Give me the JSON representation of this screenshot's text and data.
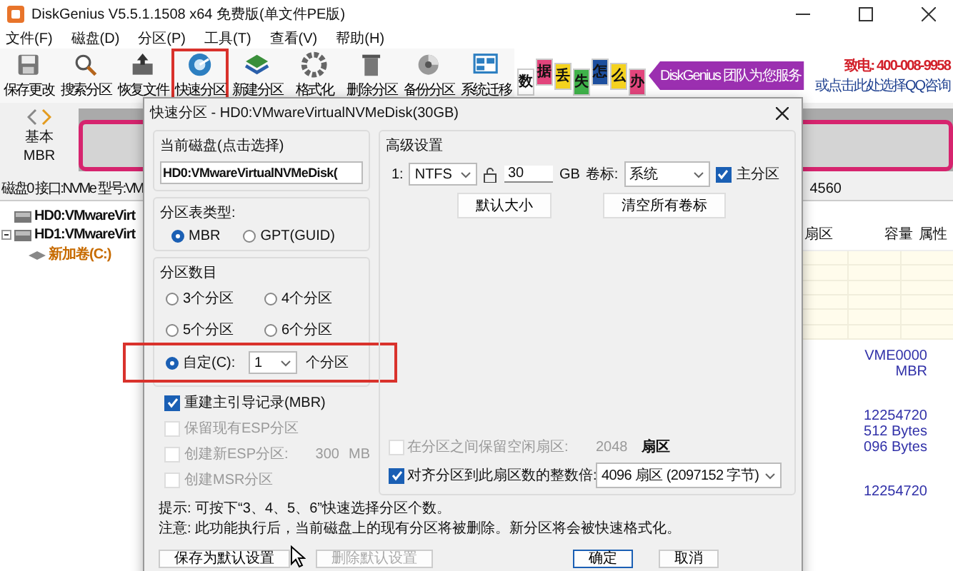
{
  "window": {
    "title": "DiskGenius V5.5.1.1508 x64 免费版(单文件PE版)"
  },
  "menu": [
    "文件(F)",
    "磁盘(D)",
    "分区(P)",
    "工具(T)",
    "查看(V)",
    "帮助(H)"
  ],
  "toolbar": [
    {
      "label": "保存更改",
      "highlighted": false
    },
    {
      "label": "搜索分区",
      "highlighted": false
    },
    {
      "label": "恢复文件",
      "highlighted": false
    },
    {
      "label": "快速分区",
      "highlighted": true
    },
    {
      "label": "新建分区",
      "highlighted": false
    },
    {
      "label": "格式化",
      "highlighted": false
    },
    {
      "label": "删除分区",
      "highlighted": false
    },
    {
      "label": "备份分区",
      "highlighted": false
    },
    {
      "label": "系统迁移",
      "highlighted": false
    }
  ],
  "banner": {
    "tiles": [
      {
        "text": "数",
        "color": "#ffffff"
      },
      {
        "text": "据",
        "color": "#e2457c"
      },
      {
        "text": "丢",
        "color": "#f4d21f"
      },
      {
        "text": "失",
        "color": "#3fb24a"
      },
      {
        "text": "怎",
        "color": "#1d4f9e"
      },
      {
        "text": "么",
        "color": "#f4d21f"
      },
      {
        "text": "办",
        "color": "#e2457c"
      }
    ],
    "slogan": "DiskGenius 团队为您服务",
    "phone": "致电: 400-008-9958",
    "qq": "或点击此处选择QQ咨询"
  },
  "disk_map": {
    "type": "基本",
    "scheme": "MBR"
  },
  "disk_info": {
    "text": "磁盘0 接口:NVMe 型号:VM",
    "tail": "4560"
  },
  "tree": [
    {
      "label": "HD0:VMwareVirt"
    },
    {
      "label": "HD1:VMwareVirt",
      "children": [
        {
          "label": "新加卷(C:)"
        }
      ]
    }
  ],
  "table": {
    "columns": [
      "扇区",
      "容量",
      "属性"
    ]
  },
  "details": [
    [
      "VME0000",
      "MBR"
    ],
    [
      "12254720",
      "512 Bytes",
      "096 Bytes"
    ],
    [
      "12254720"
    ]
  ],
  "dialog": {
    "title": "快速分区 - HD0:VMwareVirtualNVMeDisk(30GB)",
    "current_disk": {
      "label": "当前磁盘(点击选择)",
      "value": "HD0:VMwareVirtualNVMeDisk("
    },
    "partition_table": {
      "label": "分区表类型:",
      "options": [
        {
          "label": "MBR",
          "selected": true
        },
        {
          "label": "GPT(GUID)",
          "selected": false
        }
      ]
    },
    "partition_count": {
      "label": "分区数目",
      "options": [
        {
          "label": "3个分区",
          "selected": false
        },
        {
          "label": "4个分区",
          "selected": false
        },
        {
          "label": "5个分区",
          "selected": false
        },
        {
          "label": "6个分区",
          "selected": false
        }
      ],
      "custom": {
        "label": "自定(C):",
        "selected": true,
        "value": "1",
        "unit": "个分区",
        "highlighted": true
      }
    },
    "options": [
      {
        "label": "重建主引导记录(MBR)",
        "checked": true,
        "disabled": false
      },
      {
        "label": "保留现有ESP分区",
        "checked": false,
        "disabled": true
      },
      {
        "label": "创建新ESP分区:",
        "checked": false,
        "disabled": true,
        "value": "300",
        "unit": "MB"
      },
      {
        "label": "创建MSR分区",
        "checked": false,
        "disabled": true
      }
    ],
    "advanced": {
      "label": "高级设置",
      "partitions": [
        {
          "index": "1:",
          "filesystem": "NTFS",
          "size": "30",
          "unit": "GB",
          "label_caption": "卷标:",
          "volume_label": "系统",
          "primary_label": "主分区",
          "primary": true
        }
      ],
      "buttons": [
        "默认大小",
        "清空所有卷标"
      ],
      "reserve_gap": {
        "label": "在分区之间保留空闲扇区:",
        "checked": false,
        "disabled": true,
        "value": "2048",
        "unit": "扇区"
      },
      "align": {
        "label": "对齐分区到此扇区数的整数倍:",
        "checked": true,
        "disabled": false,
        "value": "4096 扇区 (2097152 字节)"
      }
    },
    "hints": [
      "提示: 可按下“3、4、5、6”快速选择分区个数。",
      "注意: 此功能执行后，当前磁盘上的现有分区将被删除。新分区将会被快速格式化。"
    ],
    "buttons": [
      {
        "label": "保存为默认设置",
        "disabled": false,
        "default": false
      },
      {
        "label": "删除默认设置",
        "disabled": true,
        "default": false
      },
      {
        "label": "确定",
        "disabled": false,
        "default": true
      },
      {
        "label": "取消",
        "disabled": false,
        "default": false
      }
    ]
  }
}
